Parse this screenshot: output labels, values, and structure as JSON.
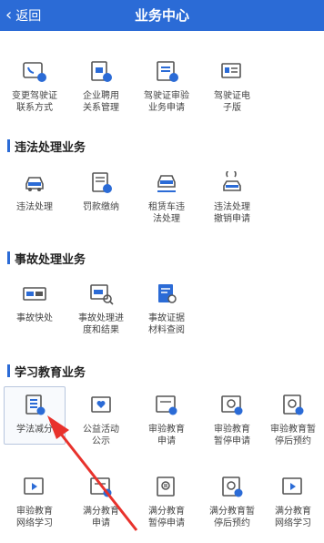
{
  "header": {
    "back_label": "返回",
    "title": "业务中心"
  },
  "top_items": [
    {
      "label": "变更驾驶证\n联系方式"
    },
    {
      "label": "企业聘用\n关系管理"
    },
    {
      "label": "驾驶证审验\n业务申请"
    },
    {
      "label": "驾驶证电\n子版"
    }
  ],
  "sections": {
    "violation": "违法处理业务",
    "accident": "事故处理业务",
    "education": "学习教育业务"
  },
  "violation_items": [
    {
      "label": "违法处理"
    },
    {
      "label": "罚款缴纳"
    },
    {
      "label": "租赁车违\n法处理"
    },
    {
      "label": "违法处理\n撤销申请"
    }
  ],
  "accident_items": [
    {
      "label": "事故快处"
    },
    {
      "label": "事故处理进\n度和结果"
    },
    {
      "label": "事故证据\n材料查阅"
    }
  ],
  "education_items": [
    {
      "label": "学法减分"
    },
    {
      "label": "公益活动\n公示"
    },
    {
      "label": "审验教育\n申请"
    },
    {
      "label": "审验教育\n暂停申请"
    },
    {
      "label": "审验教育暂\n停后预约"
    },
    {
      "label": "审验教育\n网络学习"
    },
    {
      "label": "满分教育\n申请"
    },
    {
      "label": "满分教育\n暂停申请"
    },
    {
      "label": "满分教育暂\n停后预约"
    },
    {
      "label": "满分教育\n网络学习"
    }
  ],
  "colors": {
    "header_bg": "#2b6bd6",
    "icon_blue": "#2b6bd6",
    "arrow": "#e8322c"
  }
}
